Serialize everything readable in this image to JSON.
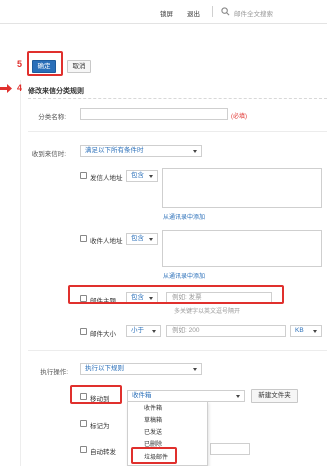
{
  "topbar": {
    "link_1": "锁屏",
    "link_2": "退出",
    "search_placeholder": "邮件全文搜索"
  },
  "steps": {
    "step_5": "5",
    "step_4": "4"
  },
  "toolbar": {
    "confirm_label": "确定",
    "cancel_label": "取消"
  },
  "section_title": "修改来信分类规则",
  "name_field": {
    "label": "分类名称:",
    "value": "",
    "required_hint": "(必填)"
  },
  "received_when": {
    "label": "收到来信时:",
    "selected": "满足以下所有条件时"
  },
  "conditions": {
    "sender": {
      "label": "发信人地址",
      "operator": "包含",
      "link": "从通讯录中添加"
    },
    "recipient": {
      "label": "收件人地址",
      "operator": "包含",
      "link": "从通讯录中添加"
    },
    "subject": {
      "label": "邮件主题",
      "operator": "包含",
      "placeholder": "例如: 发票",
      "hint": "多关键字以英文逗号隔开"
    },
    "size": {
      "label": "邮件大小",
      "operator": "小于",
      "placeholder": "例如: 200",
      "unit": "KB"
    }
  },
  "actions": {
    "label": "执行操作:",
    "selected": "执行以下规则",
    "move_to": {
      "label": "移动到",
      "folder": "收件箱",
      "new_folder_button": "新建文件夹"
    },
    "mark_as": {
      "label": "标记为"
    },
    "auto_forward": {
      "label": "自动转发"
    }
  },
  "folder_options": [
    "收件箱",
    "草稿箱",
    "已发送",
    "已删除",
    "垃圾邮件"
  ],
  "colors": {
    "accent": "#2a6fb9",
    "highlight": "#e0302d"
  }
}
